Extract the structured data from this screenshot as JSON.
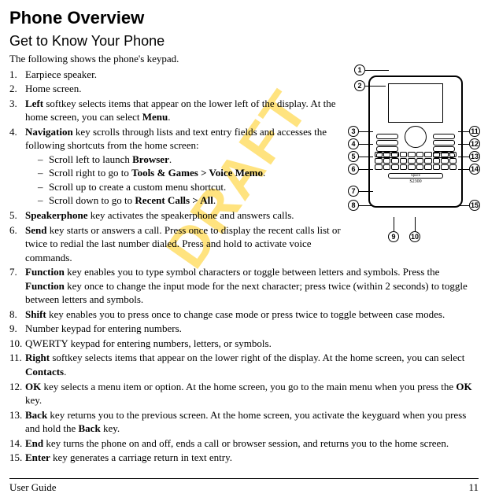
{
  "title": "Phone Overview",
  "subtitle": "Get to Know Your Phone",
  "intro": "The following shows the phone's keypad.",
  "items": [
    {
      "pre": "",
      "bold": "",
      "post": "Earpiece speaker."
    },
    {
      "pre": "",
      "bold": "",
      "post": "Home screen."
    },
    {
      "pre": "",
      "bold": "Left",
      "post": " softkey selects items that appear on the lower left of the display. At the home screen, you can select ",
      "bold2": "Menu",
      "post2": "."
    },
    {
      "pre": "",
      "bold": "Navigation",
      "post": " key scrolls through lists and text entry fields and accesses the following shortcuts from the home screen:",
      "sub": [
        {
          "pre": "Scroll left to launch ",
          "bold": "Browser",
          "post": "."
        },
        {
          "pre": "Scroll right to go to ",
          "bold": "Tools & Games > Voice Memo",
          "post": "."
        },
        {
          "pre": "Scroll up to create a custom menu shortcut.",
          "bold": "",
          "post": ""
        },
        {
          "pre": "Scroll down to go to ",
          "bold": "Recent Calls > All",
          "post": "."
        }
      ]
    },
    {
      "pre": "",
      "bold": "Speakerphone",
      "post": " key activates the speakerphone and answers calls."
    },
    {
      "pre": "",
      "bold": "Send",
      "post": " key starts or answers a call. Press once to display the recent calls list or twice to redial the last number dialed. Press and hold to activate voice commands."
    },
    {
      "pre": "",
      "bold": "Function",
      "post": " key enables you to type symbol characters or toggle between letters and symbols. Press the ",
      "bold2": "Function",
      "post2": " key once to change the input mode for the next character; press twice (within 2 seconds) to toggle between letters and symbols."
    },
    {
      "pre": "",
      "bold": "Shift",
      "post": " key enables you to press once to change case mode or press twice to toggle between case modes."
    },
    {
      "pre": "",
      "bold": "",
      "post": "Number keypad for entering numbers."
    },
    {
      "pre": "",
      "bold": "",
      "post": "QWERTY keypad for entering numbers, letters, or symbols."
    },
    {
      "pre": "",
      "bold": "Right",
      "post": " softkey selects items that appear on the lower right of the display. At the home screen, you can select ",
      "bold2": "Contacts",
      "post2": "."
    },
    {
      "pre": "",
      "bold": "OK",
      "post": " key selects a menu item or option. At the home screen, you go to the main menu when you press the ",
      "bold2": "OK",
      "post2": " key."
    },
    {
      "pre": "",
      "bold": "Back",
      "post": " key returns you to the previous screen. At the home screen, you activate the keyguard when you press and hold the ",
      "bold2": "Back",
      "post2": " key."
    },
    {
      "pre": "",
      "bold": "End",
      "post": " key turns the phone on and off, ends a call or browser session, and returns you to the home screen."
    },
    {
      "pre": "",
      "bold": "Enter",
      "post": " key generates a carriage return in text entry."
    }
  ],
  "phone": {
    "model": "S2300",
    "spacebar": "Space"
  },
  "callouts": [
    "1",
    "2",
    "3",
    "4",
    "5",
    "6",
    "7",
    "8",
    "9",
    "10",
    "11",
    "12",
    "13",
    "14",
    "15"
  ],
  "footer": {
    "left": "User Guide",
    "right": "11"
  },
  "watermark": "DRAFT"
}
